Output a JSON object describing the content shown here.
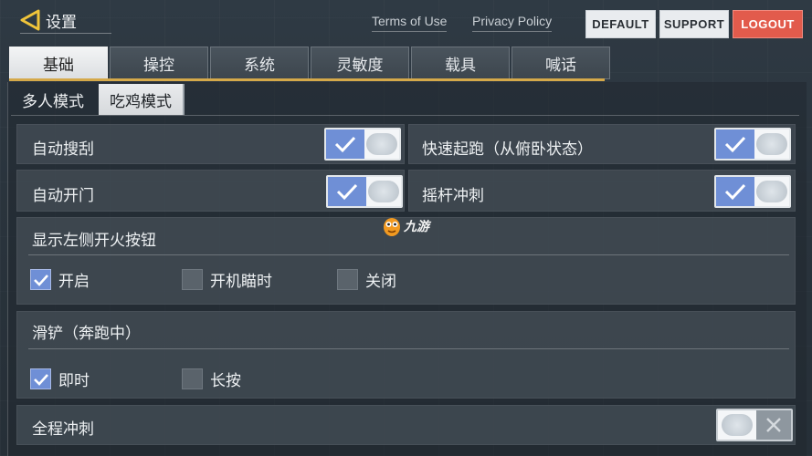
{
  "header": {
    "title": "设置",
    "links": {
      "terms": "Terms of Use",
      "privacy": "Privacy Policy"
    },
    "buttons": {
      "default": "DEFAULT",
      "support": "SUPPORT",
      "logout": "LOGOUT"
    }
  },
  "tabs": [
    "基础",
    "操控",
    "系统",
    "灵敏度",
    "载具",
    "喊话"
  ],
  "active_tab": "基础",
  "subtabs": [
    "多人模式",
    "吃鸡模式"
  ],
  "active_subtab": "吃鸡模式",
  "settings": {
    "auto_pickup": {
      "label": "自动搜刮",
      "enabled": true
    },
    "quick_sprint": {
      "label": "快速起跑（从俯卧状态）",
      "enabled": true
    },
    "auto_door": {
      "label": "自动开门",
      "enabled": true
    },
    "joystick_sprint": {
      "label": "摇杆冲刺",
      "enabled": true
    },
    "left_fire": {
      "label": "显示左侧开火按钮",
      "options": [
        "开启",
        "开机瞄时",
        "关闭"
      ],
      "selected": "开启"
    },
    "slide": {
      "label": "滑铲（奔跑中）",
      "options": [
        "即时",
        "长按"
      ],
      "selected": "即时"
    },
    "full_sprint": {
      "label": "全程冲刺",
      "enabled": false
    }
  },
  "watermark": {
    "text": "九游"
  },
  "colors": {
    "accent_blue": "#6f8fd6",
    "logout_red": "#e25b4c",
    "tab_gold": "#d5a94a"
  }
}
